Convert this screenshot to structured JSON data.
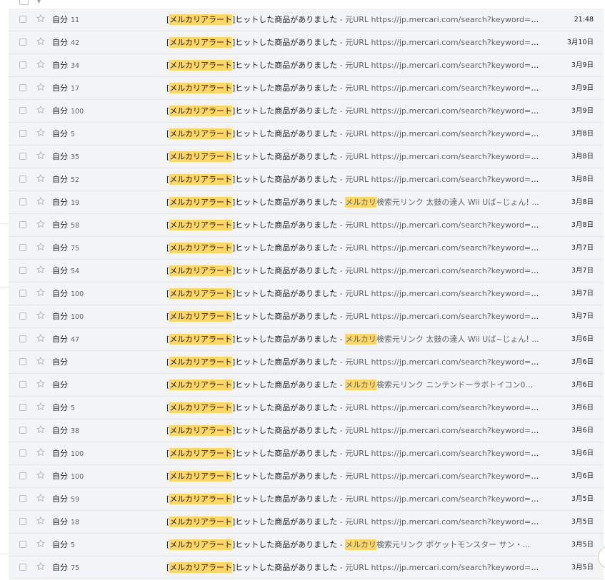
{
  "inbox": {
    "rows": [
      {
        "sender": "自分",
        "count": "11",
        "subject_hl": "メルカリアラート",
        "subject_rest": "ヒットした商品がありました",
        "snippet_hl": "",
        "snippet": "元URL https://jp.mercari.com/search?keyword=%E...",
        "date": "21:48"
      },
      {
        "sender": "自分",
        "count": "42",
        "subject_hl": "メルカリアラート",
        "subject_rest": "ヒットした商品がありました",
        "snippet_hl": "",
        "snippet": "元URL https://jp.mercari.com/search?keyword=%E...",
        "date": "3月10日"
      },
      {
        "sender": "自分",
        "count": "34",
        "subject_hl": "メルカリアラート",
        "subject_rest": "ヒットした商品がありました",
        "snippet_hl": "",
        "snippet": "元URL https://jp.mercari.com/search?keyword=%E...",
        "date": "3月9日"
      },
      {
        "sender": "自分",
        "count": "17",
        "subject_hl": "メルカリアラート",
        "subject_rest": "ヒットした商品がありました",
        "snippet_hl": "",
        "snippet": "元URL https://jp.mercari.com/search?keyword=%E...",
        "date": "3月9日"
      },
      {
        "sender": "自分",
        "count": "100",
        "subject_hl": "メルカリアラート",
        "subject_rest": "ヒットした商品がありました",
        "snippet_hl": "",
        "snippet": "元URL https://jp.mercari.com/search?keyword=%E...",
        "date": "3月9日"
      },
      {
        "sender": "自分",
        "count": "5",
        "subject_hl": "メルカリアラート",
        "subject_rest": "ヒットした商品がありました",
        "snippet_hl": "",
        "snippet": "元URL https://jp.mercari.com/search?keyword=%E...",
        "date": "3月8日"
      },
      {
        "sender": "自分",
        "count": "35",
        "subject_hl": "メルカリアラート",
        "subject_rest": "ヒットした商品がありました",
        "snippet_hl": "",
        "snippet": "元URL https://jp.mercari.com/search?keyword=%E...",
        "date": "3月8日"
      },
      {
        "sender": "自分",
        "count": "52",
        "subject_hl": "メルカリアラート",
        "subject_rest": "ヒットした商品がありました",
        "snippet_hl": "",
        "snippet": "元URL https://jp.mercari.com/search?keyword=Ne...",
        "date": "3月8日"
      },
      {
        "sender": "自分",
        "count": "19",
        "subject_hl": "メルカリアラート",
        "subject_rest": "ヒットした商品がありました",
        "snippet_hl": "メルカリ",
        "snippet": "検索元リンク 太鼓の達人 Wii Uば~じょん! ...",
        "date": "3月8日"
      },
      {
        "sender": "自分",
        "count": "58",
        "subject_hl": "メルカリアラート",
        "subject_rest": "ヒットした商品がありました",
        "snippet_hl": "",
        "snippet": "元URL https://jp.mercari.com/search?keyword=The...",
        "date": "3月8日"
      },
      {
        "sender": "自分",
        "count": "75",
        "subject_hl": "メルカリアラート",
        "subject_rest": "ヒットした商品がありました",
        "snippet_hl": "",
        "snippet": "元URL https://jp.mercari.com/search?keyword=%E...",
        "date": "3月7日"
      },
      {
        "sender": "自分",
        "count": "54",
        "subject_hl": "メルカリアラート",
        "subject_rest": "ヒットした商品がありました",
        "snippet_hl": "",
        "snippet": "元URL https://jp.mercari.com/search?keyword=%E...",
        "date": "3月7日"
      },
      {
        "sender": "自分",
        "count": "100",
        "subject_hl": "メルカリアラート",
        "subject_rest": "ヒットした商品がありました",
        "snippet_hl": "",
        "snippet": "元URL https://jp.mercari.com/search?keyword=%E...",
        "date": "3月7日"
      },
      {
        "sender": "自分",
        "count": "100",
        "subject_hl": "メルカリアラート",
        "subject_rest": "ヒットした商品がありました",
        "snippet_hl": "",
        "snippet": "元URL https://jp.mercari.com/search?keyword=%E...",
        "date": "3月7日"
      },
      {
        "sender": "自分",
        "count": "47",
        "subject_hl": "メルカリアラート",
        "subject_rest": "ヒットした商品がありました",
        "snippet_hl": "メルカリ",
        "snippet": "検索元リンク 太鼓の達人 Wii Uば~じょん! ...",
        "date": "3月6日"
      },
      {
        "sender": "自分",
        "count": "",
        "subject_hl": "メルカリアラート",
        "subject_rest": "ヒットした商品がありました",
        "snippet_hl": "",
        "snippet": "元URL https://jp.mercari.com/search?keyword=%E...",
        "date": "3月6日"
      },
      {
        "sender": "自分",
        "count": "",
        "subject_hl": "メルカリアラート",
        "subject_rest": "ヒットした商品がありました",
        "snippet_hl": "メルカリ",
        "snippet": "検索元リンク ニンテンドーラボトイコン0...",
        "date": "3月6日"
      },
      {
        "sender": "自分",
        "count": "5",
        "subject_hl": "メルカリアラート",
        "subject_rest": "ヒットした商品がありました",
        "snippet_hl": "",
        "snippet": "元URL https://jp.mercari.com/search?keyword=%E...",
        "date": "3月6日"
      },
      {
        "sender": "自分",
        "count": "38",
        "subject_hl": "メルカリアラート",
        "subject_rest": "ヒットした商品がありました",
        "snippet_hl": "",
        "snippet": "元URL https://jp.mercari.com/search?keyword=%E...",
        "date": "3月6日"
      },
      {
        "sender": "自分",
        "count": "100",
        "subject_hl": "メルカリアラート",
        "subject_rest": "ヒットした商品がありました",
        "snippet_hl": "",
        "snippet": "元URL https://jp.mercari.com/search?keyword=%E...",
        "date": "3月6日"
      },
      {
        "sender": "自分",
        "count": "100",
        "subject_hl": "メルカリアラート",
        "subject_rest": "ヒットした商品がありました",
        "snippet_hl": "",
        "snippet": "元URL https://jp.mercari.com/search?keyword=%E...",
        "date": "3月6日"
      },
      {
        "sender": "自分",
        "count": "59",
        "subject_hl": "メルカリアラート",
        "subject_rest": "ヒットした商品がありました",
        "snippet_hl": "",
        "snippet": "元URL https://jp.mercari.com/search?keyword=ami...",
        "date": "3月5日"
      },
      {
        "sender": "自分",
        "count": "18",
        "subject_hl": "メルカリアラート",
        "subject_rest": "ヒットした商品がありました",
        "snippet_hl": "",
        "snippet": "元URL https://jp.mercari.com/search?keyword=%E...",
        "date": "3月5日"
      },
      {
        "sender": "自分",
        "count": "5",
        "subject_hl": "メルカリアラート",
        "subject_rest": "ヒットした商品がありました",
        "snippet_hl": "メルカリ",
        "snippet": "検索元リンク ポケットモンスター サン・...",
        "date": "3月5日"
      },
      {
        "sender": "自分",
        "count": "75",
        "subject_hl": "メルカリアラート",
        "subject_rest": "ヒットした商品がありました",
        "snippet_hl": "",
        "snippet": "元URL https://jp.mercari.com/search?keyword=%E...",
        "date": "3月5日"
      }
    ]
  },
  "colors": {
    "row_bg": "#f3f4f6",
    "highlight": "#fdd663",
    "divider": "#e2e3e5"
  },
  "icons": {
    "checkbox": "checkbox-icon",
    "star": "star-icon"
  }
}
